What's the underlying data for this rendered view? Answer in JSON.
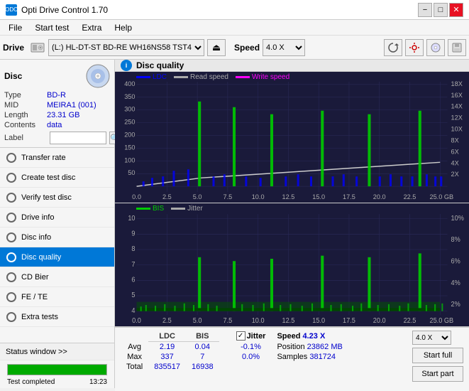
{
  "app": {
    "title": "Opti Drive Control 1.70",
    "icon": "ODC"
  },
  "title_controls": {
    "minimize": "−",
    "maximize": "□",
    "close": "✕"
  },
  "menu": {
    "items": [
      "File",
      "Start test",
      "Extra",
      "Help"
    ]
  },
  "toolbar": {
    "drive_label": "Drive",
    "drive_value": "(L:)  HL-DT-ST BD-RE  WH16NS58 TST4",
    "speed_label": "Speed",
    "speed_value": "4.0 X"
  },
  "disc_section": {
    "title": "Disc",
    "type_label": "Type",
    "type_val": "BD-R",
    "mid_label": "MID",
    "mid_val": "MEIRA1 (001)",
    "length_label": "Length",
    "length_val": "23.31 GB",
    "contents_label": "Contents",
    "contents_val": "data",
    "label_label": "Label"
  },
  "nav": {
    "items": [
      {
        "id": "transfer-rate",
        "label": "Transfer rate",
        "active": false
      },
      {
        "id": "create-test-disc",
        "label": "Create test disc",
        "active": false
      },
      {
        "id": "verify-test-disc",
        "label": "Verify test disc",
        "active": false
      },
      {
        "id": "drive-info",
        "label": "Drive info",
        "active": false
      },
      {
        "id": "disc-info",
        "label": "Disc info",
        "active": false
      },
      {
        "id": "disc-quality",
        "label": "Disc quality",
        "active": true
      },
      {
        "id": "cd-bier",
        "label": "CD Bier",
        "active": false
      },
      {
        "id": "fe-te",
        "label": "FE / TE",
        "active": false
      },
      {
        "id": "extra-tests",
        "label": "Extra tests",
        "active": false
      }
    ]
  },
  "status": {
    "window_label": "Status window >>",
    "progress": 100,
    "status_text": "Test completed",
    "time": "13:23"
  },
  "disc_quality": {
    "title": "Disc quality",
    "icon": "i",
    "legend_top": [
      {
        "label": "LDC",
        "color": "#0000ff"
      },
      {
        "label": "Read speed",
        "color": "#999999"
      },
      {
        "label": "Write speed",
        "color": "#ff00ff"
      }
    ],
    "legend_bottom": [
      {
        "label": "BIS",
        "color": "#00cc00"
      },
      {
        "label": "Jitter",
        "color": "#000000"
      }
    ],
    "top_chart": {
      "y_left_max": 400,
      "y_left_min": 0,
      "y_right_labels": [
        "18X",
        "16X",
        "14X",
        "12X",
        "10X",
        "8X",
        "6X",
        "4X",
        "2X"
      ],
      "x_labels": [
        "0.0",
        "2.5",
        "5.0",
        "7.5",
        "10.0",
        "12.5",
        "15.0",
        "17.5",
        "20.0",
        "22.5",
        "25.0 GB"
      ]
    },
    "bottom_chart": {
      "y_left_max": 10,
      "y_right_labels": [
        "10%",
        "8%",
        "6%",
        "4%",
        "2%"
      ],
      "x_labels": [
        "0.0",
        "2.5",
        "5.0",
        "7.5",
        "10.0",
        "12.5",
        "15.0",
        "17.5",
        "20.0",
        "22.5",
        "25.0 GB"
      ]
    },
    "stats": {
      "headers": [
        "LDC",
        "BIS",
        "",
        "Jitter",
        "Speed"
      ],
      "avg_label": "Avg",
      "avg_ldc": "2.19",
      "avg_bis": "0.04",
      "avg_jitter": "-0.1%",
      "max_label": "Max",
      "max_ldc": "337",
      "max_bis": "7",
      "max_jitter": "0.0%",
      "total_label": "Total",
      "total_ldc": "835517",
      "total_bis": "16938",
      "jitter_checked": true,
      "speed_label": "Speed",
      "speed_val": "4.23 X",
      "speed_select": "4.0 X",
      "position_label": "Position",
      "position_val": "23862 MB",
      "samples_label": "Samples",
      "samples_val": "381724",
      "btn_start_full": "Start full",
      "btn_start_part": "Start part"
    }
  }
}
